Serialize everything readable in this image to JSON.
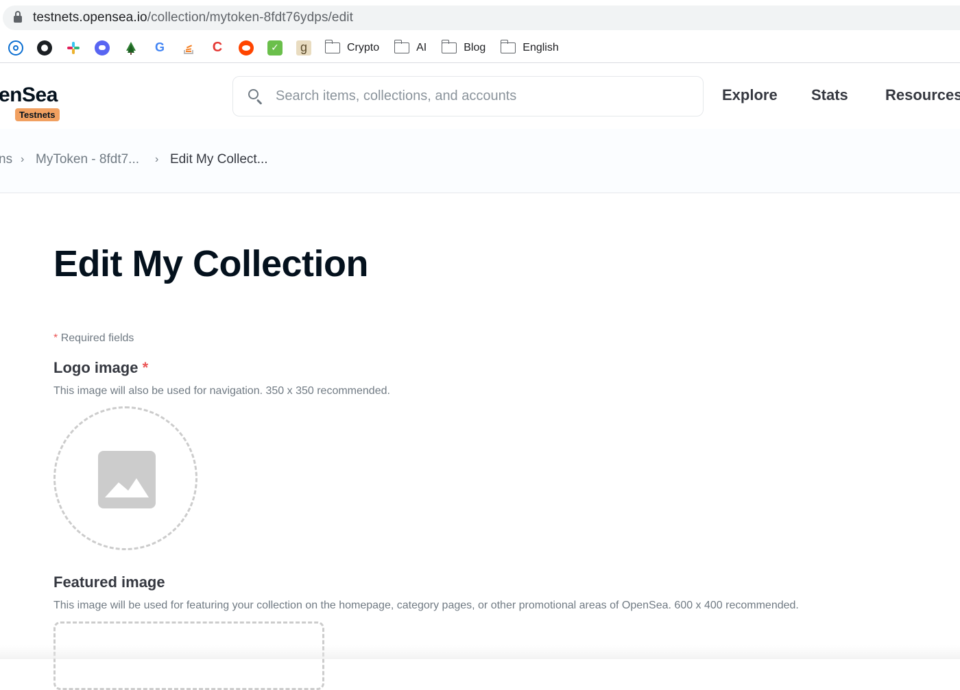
{
  "browser": {
    "url_host": "testnets.opensea.io",
    "url_path": "/collection/mytoken-8fdt76ydps/edit"
  },
  "bookmarks": {
    "icons": [
      "1password-icon",
      "github-icon",
      "slack-icon",
      "discord-icon",
      "tree-icon",
      "google-icon",
      "stackoverflow-icon",
      "c-icon",
      "reddit-icon",
      "check-icon",
      "g-icon"
    ],
    "folders": [
      "Crypto",
      "AI",
      "Blog",
      "English"
    ]
  },
  "header": {
    "logo_text": "enSea",
    "badge": "Testnets",
    "search_placeholder": "Search items, collections, and accounts",
    "nav": [
      "Explore",
      "Stats",
      "Resources"
    ]
  },
  "breadcrumb": {
    "items": [
      "ns",
      "MyToken - 8fdt7...",
      "Edit My Collect..."
    ],
    "separator": "›"
  },
  "main": {
    "title": "Edit My Collection",
    "required_marker": "*",
    "required_note": "Required fields",
    "logo_label": "Logo image",
    "logo_help": "This image will also be used for navigation. 350 x 350 recommended.",
    "featured_label": "Featured image",
    "featured_help": "This image will be used for featuring your collection on the homepage, category pages, or other promotional areas of OpenSea. 600 x 400 recommended."
  },
  "colors": {
    "accent_badge": "#f1a060",
    "required_star": "#eb5757",
    "text_dark": "#04111d",
    "text_muted": "#707a83"
  }
}
